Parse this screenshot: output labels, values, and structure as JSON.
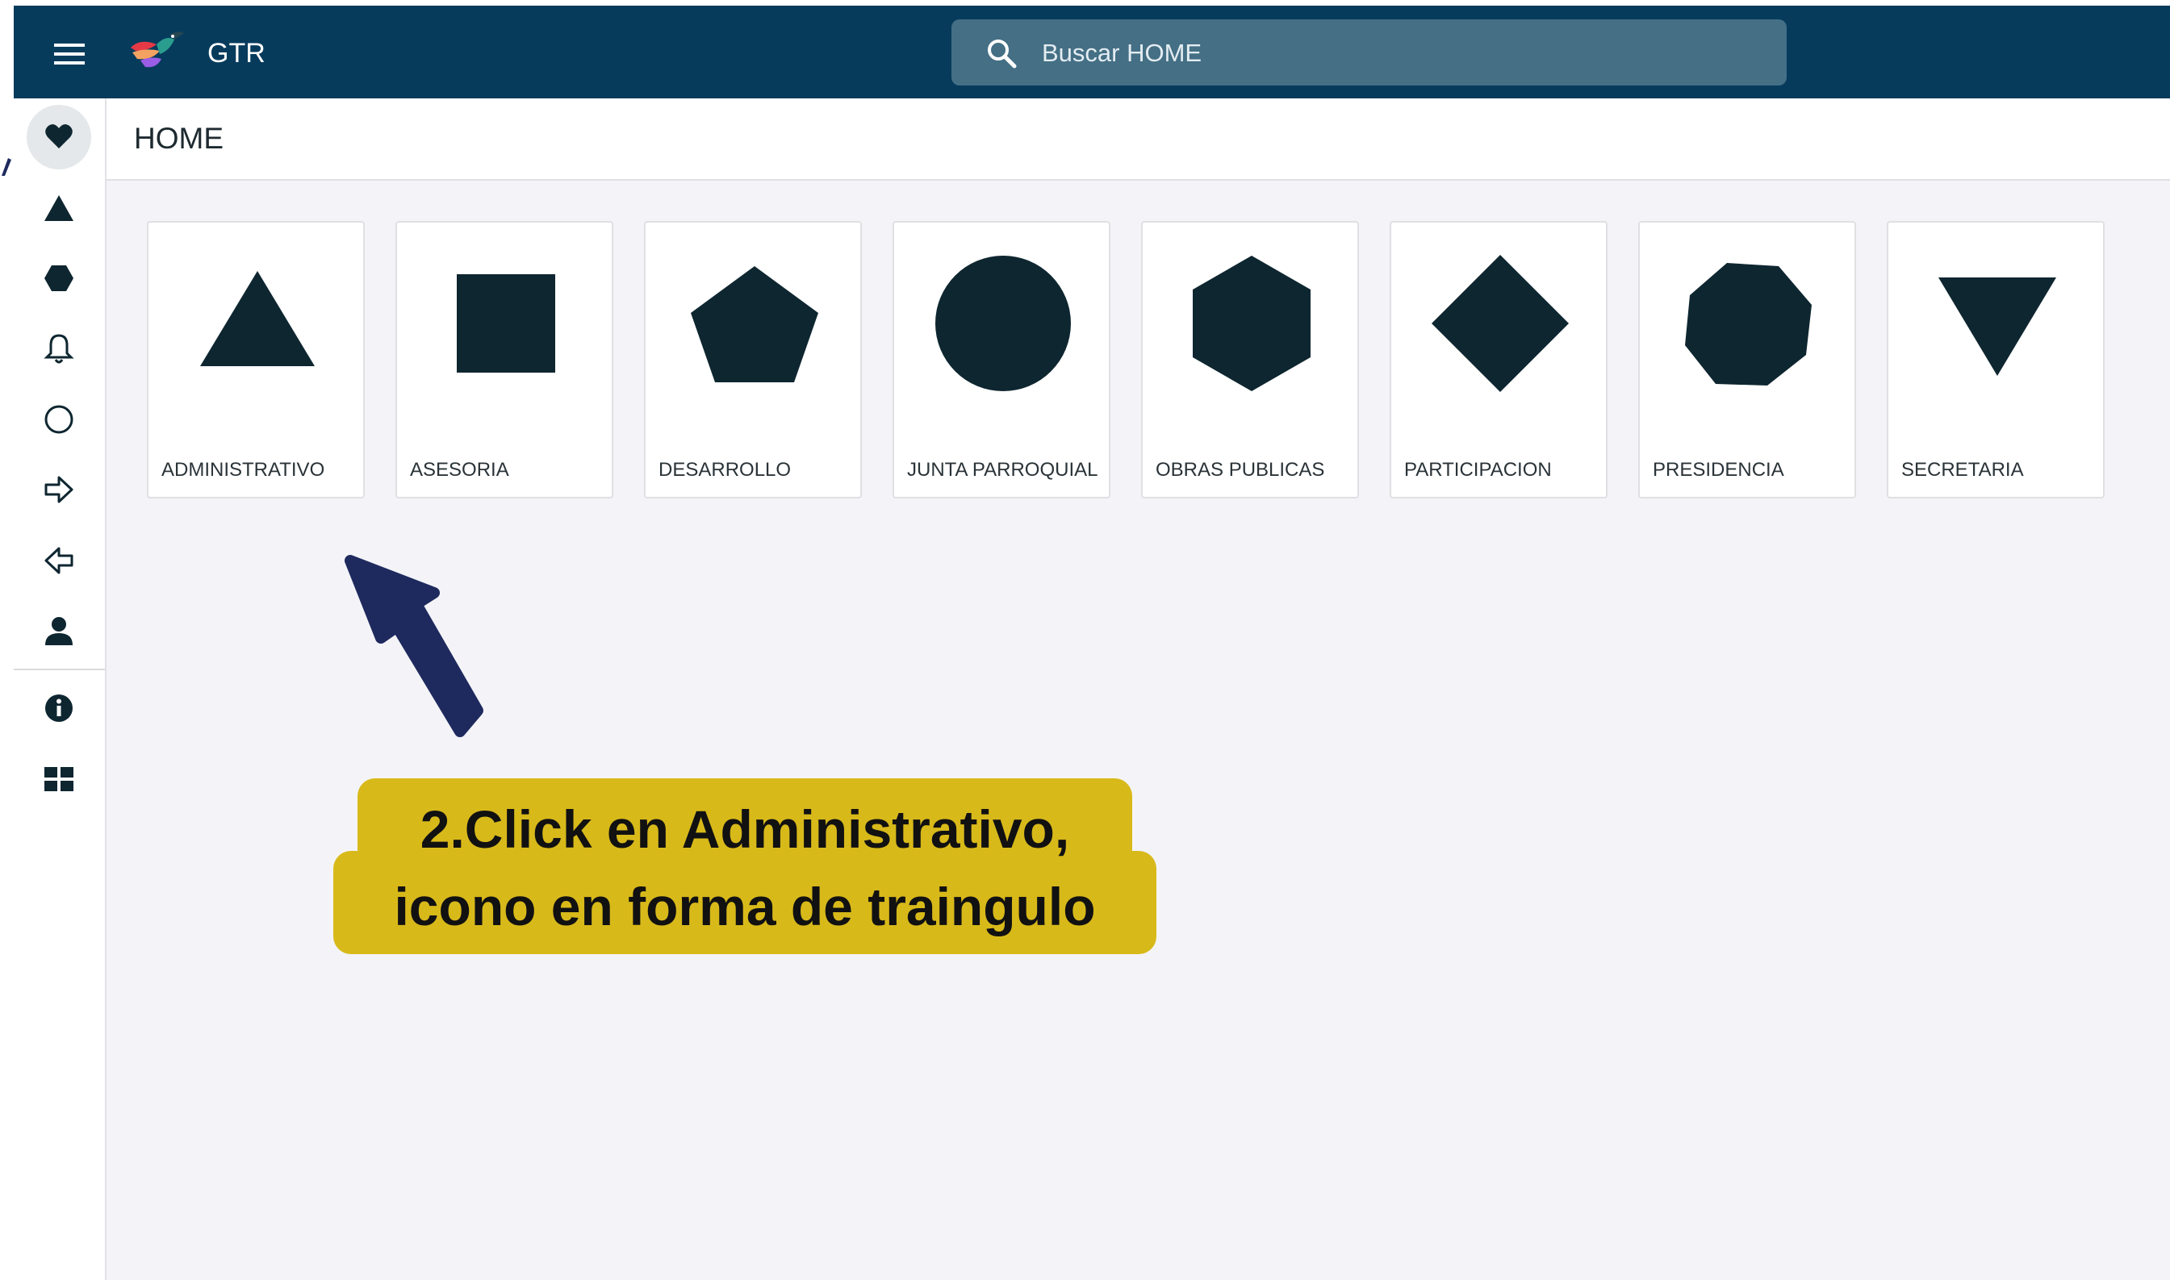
{
  "topbar": {
    "app_title": "GTR",
    "search_placeholder": "Buscar HOME"
  },
  "page": {
    "title": "HOME"
  },
  "cards": [
    {
      "label": "ADMINISTRATIVO",
      "shape": "triangle-icon"
    },
    {
      "label": "ASESORIA",
      "shape": "square-icon"
    },
    {
      "label": "DESARROLLO",
      "shape": "pentagon-icon"
    },
    {
      "label": "JUNTA PARROQUIAL",
      "shape": "circle-icon"
    },
    {
      "label": "OBRAS PUBLICAS",
      "shape": "hexagon-icon"
    },
    {
      "label": "PARTICIPACION",
      "shape": "diamond-icon"
    },
    {
      "label": "PRESIDENCIA",
      "shape": "octagon-icon"
    },
    {
      "label": "SECRETARIA",
      "shape": "inverted-triangle-icon"
    }
  ],
  "sidebar": {
    "items": [
      {
        "icon": "heart-icon",
        "active": true
      },
      {
        "icon": "triangle-icon"
      },
      {
        "icon": "hexagon-icon"
      },
      {
        "icon": "bell-icon"
      },
      {
        "icon": "circle-outline-icon"
      },
      {
        "icon": "arrow-right-outline-icon"
      },
      {
        "icon": "arrow-left-outline-icon"
      },
      {
        "icon": "user-icon"
      },
      {
        "icon": "info-icon"
      },
      {
        "icon": "grid-icon"
      }
    ]
  },
  "annotation": {
    "line1": "2.Click en Administrativo,",
    "line2": "icono en forma de traingulo"
  },
  "colors": {
    "topbar": "#063b5c",
    "search_bg": "#446f85",
    "shape_fill": "#0e2630",
    "callout": "#d8b91a",
    "arrow": "#1e2a5e",
    "background": "#f4f4f8"
  }
}
